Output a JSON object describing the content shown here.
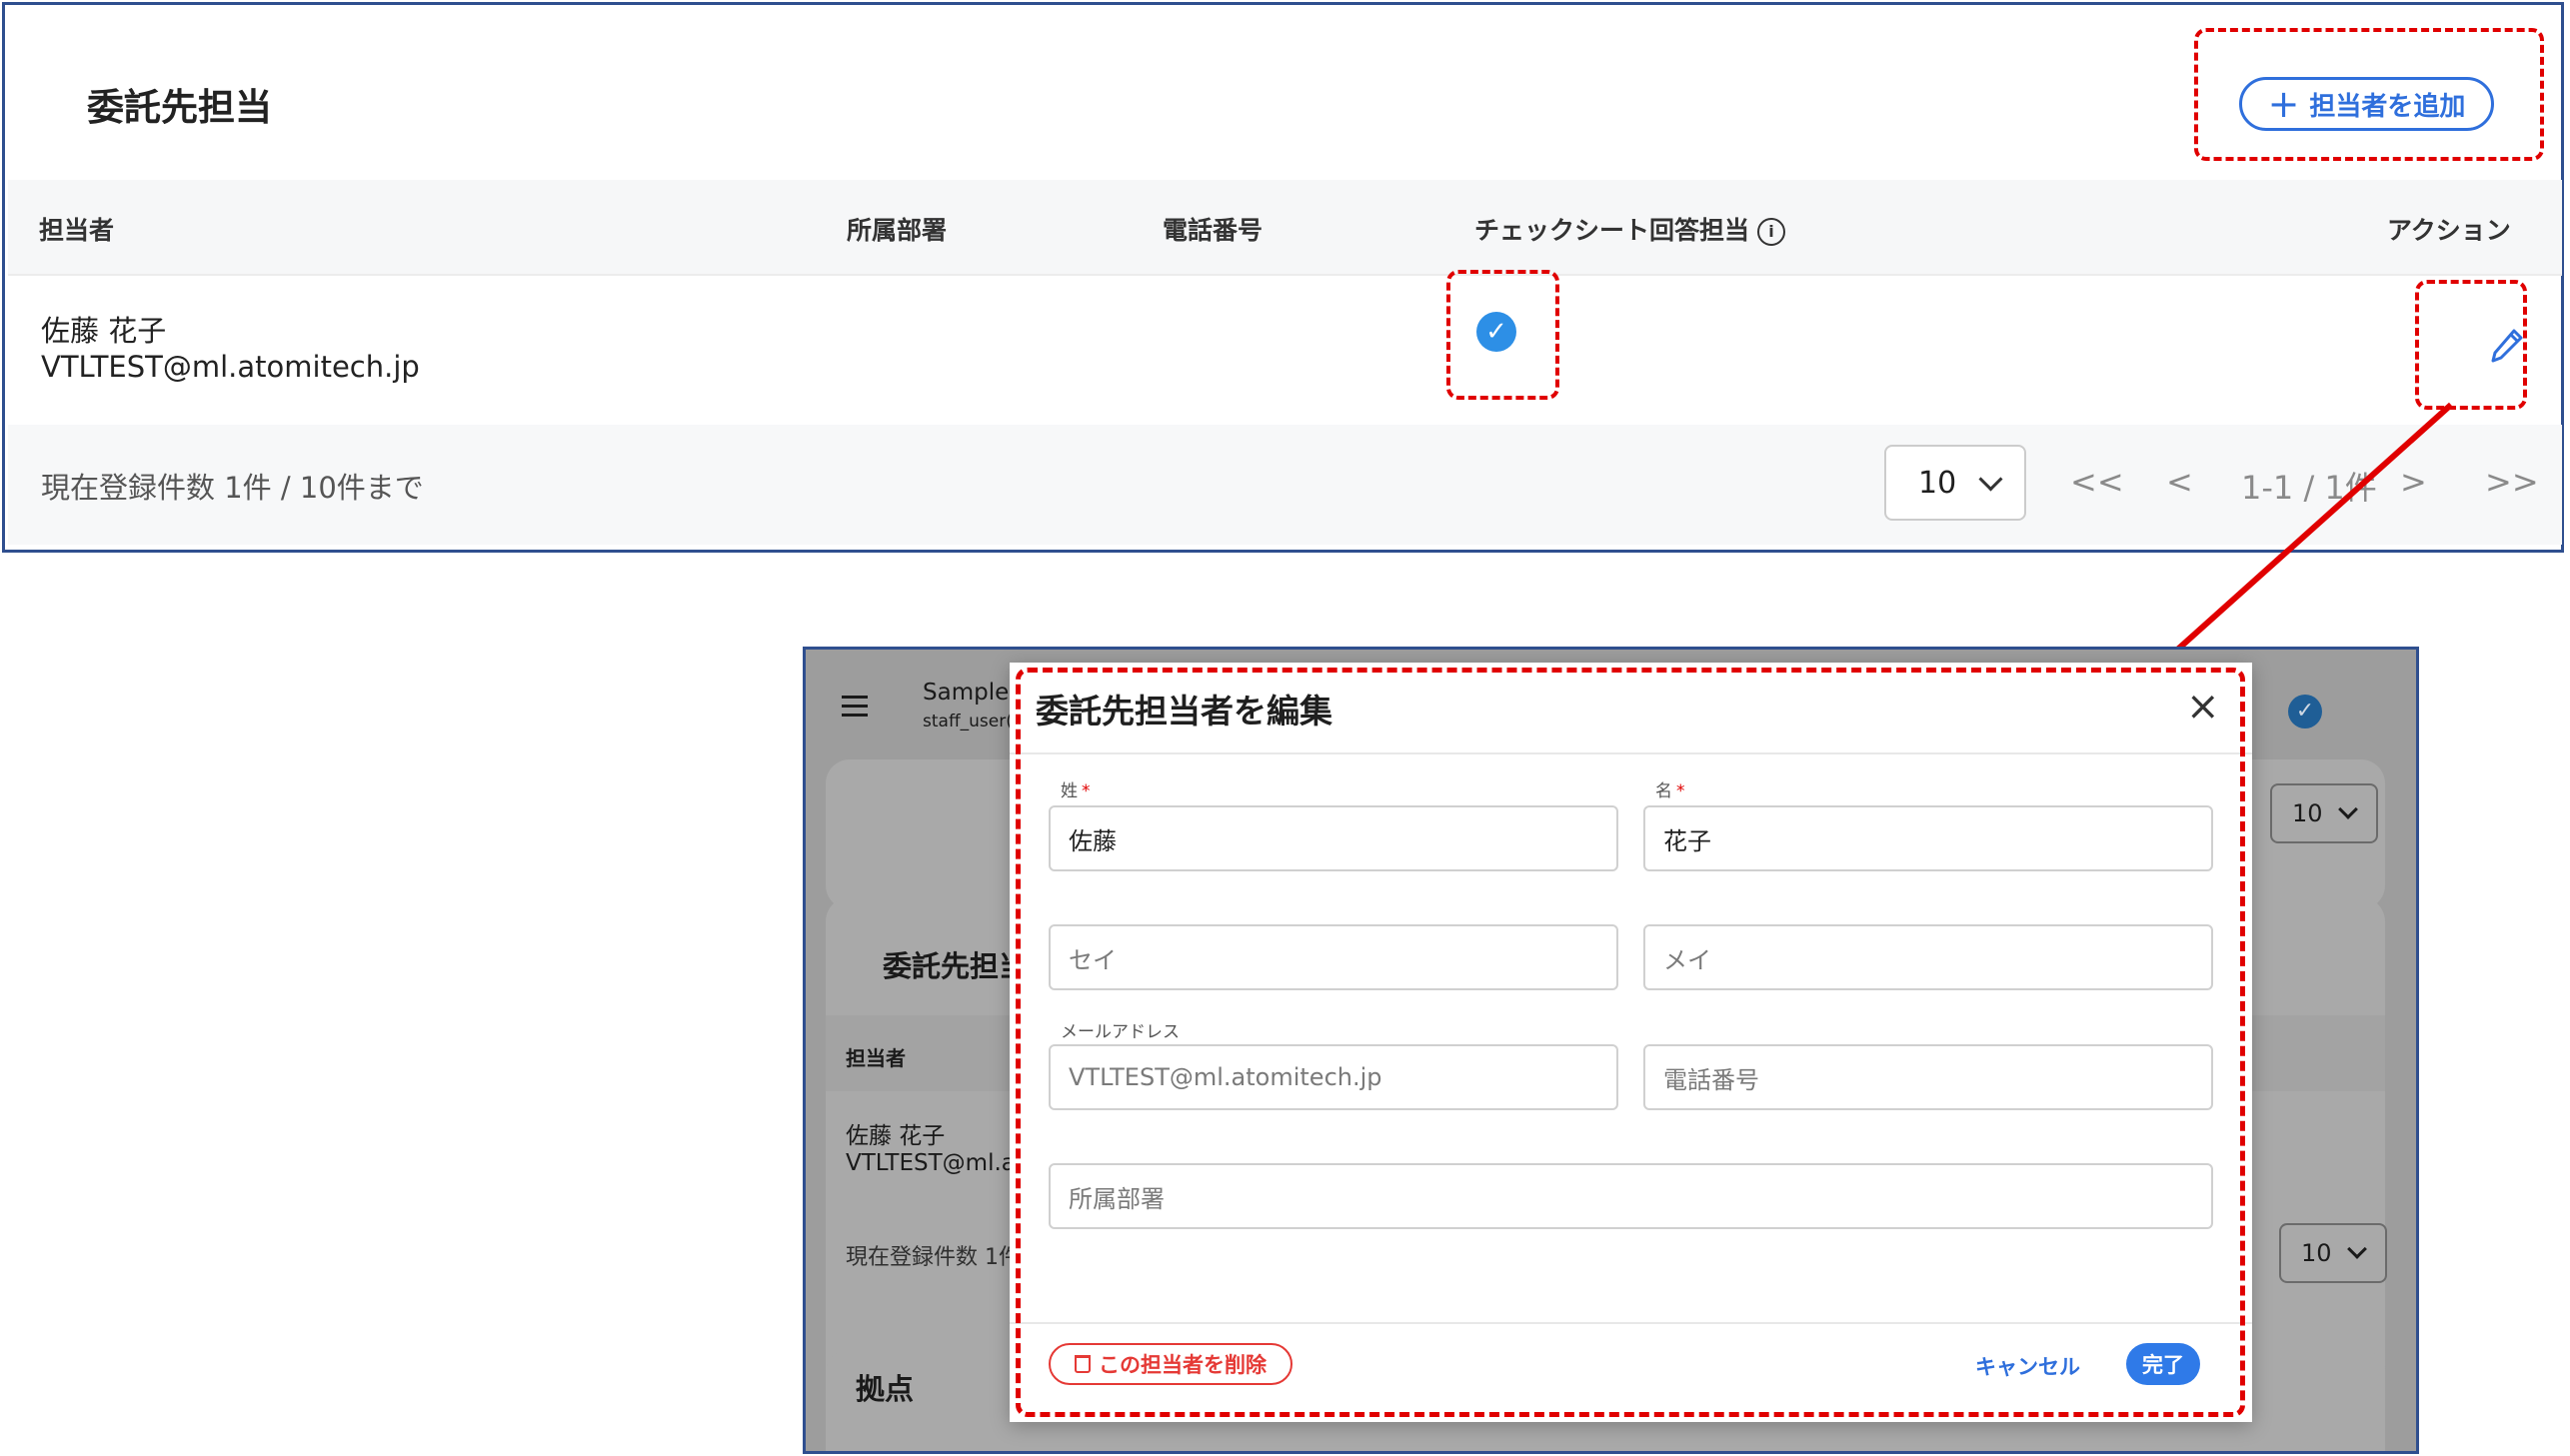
{
  "top": {
    "title": "委託先担当",
    "add_button": "担当者を追加",
    "columns": [
      "担当者",
      "所属部署",
      "電話番号",
      "チェックシート回答担当",
      "アクション"
    ],
    "row": {
      "name": "佐藤 花子",
      "email": "VTLTEST@ml.atomitech.jp",
      "checked": true
    },
    "footer": {
      "count": "現在登録件数 1件 / 10件まで",
      "page_size": "10",
      "range": "1-1 / 1件",
      "first": "<<",
      "prev": "<",
      "next": ">",
      "last": ">>"
    }
  },
  "background": {
    "app_name": "Sample :",
    "user": "staff_user(",
    "page_size_top": "10",
    "section_title": "委託先担当",
    "col_person": "担当者",
    "row_name": "佐藤 花子",
    "row_email": "VTLTEST@ml.at",
    "count": "現在登録件数 1件",
    "page_size": "10",
    "section2": "拠点"
  },
  "modal": {
    "title": "委託先担当者を編集",
    "last_name_label": "姓",
    "first_name_label": "名",
    "required_mark": "*",
    "last_name": "佐藤",
    "first_name": "花子",
    "last_kana_placeholder": "セイ",
    "first_kana_placeholder": "メイ",
    "email_label": "メールアドレス",
    "email": "VTLTEST@ml.atomitech.jp",
    "phone_placeholder": "電話番号",
    "dept_placeholder": "所属部署",
    "delete_button": "この担当者を削除",
    "cancel_button": "キャンセル",
    "done_button": "完了"
  },
  "colors": {
    "accent": "#2f6fdc",
    "danger": "#e53935",
    "highlight": "#e00000",
    "check": "#2d8fe6"
  }
}
